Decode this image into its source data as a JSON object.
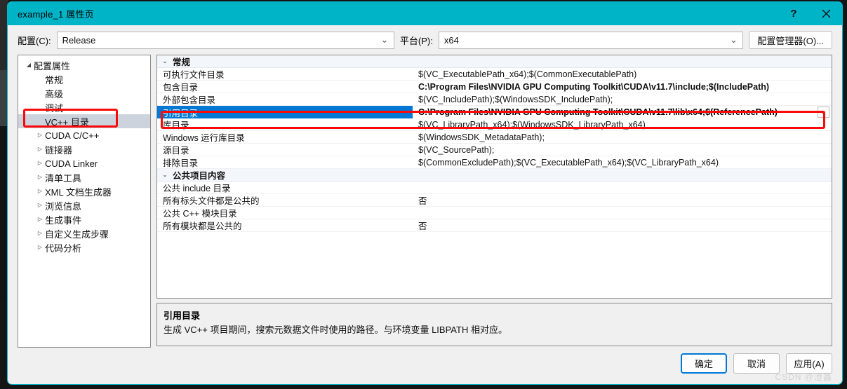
{
  "window": {
    "title": "example_1 属性页",
    "titlebar_color": "#00b4c8",
    "help_glyph": "?",
    "close_glyph": "✕"
  },
  "toolbar": {
    "config_label": "配置(C):",
    "config_value": "Release",
    "platform_label": "平台(P):",
    "platform_value": "x64",
    "config_manager_label": "配置管理器(O)...",
    "chevron_glyph": "⌄"
  },
  "tree": {
    "items": [
      {
        "label": "配置属性",
        "depth": 0,
        "expander": "expanded",
        "selected": false
      },
      {
        "label": "常规",
        "depth": 1,
        "expander": "none",
        "selected": false
      },
      {
        "label": "高级",
        "depth": 1,
        "expander": "none",
        "selected": false
      },
      {
        "label": "调试",
        "depth": 1,
        "expander": "none",
        "selected": false
      },
      {
        "label": "VC++ 目录",
        "depth": 1,
        "expander": "none",
        "selected": true
      },
      {
        "label": "CUDA C/C++",
        "depth": 1,
        "expander": "collapsed",
        "selected": false
      },
      {
        "label": "链接器",
        "depth": 1,
        "expander": "collapsed",
        "selected": false
      },
      {
        "label": "CUDA Linker",
        "depth": 1,
        "expander": "collapsed",
        "selected": false
      },
      {
        "label": "清单工具",
        "depth": 1,
        "expander": "collapsed",
        "selected": false
      },
      {
        "label": "XML 文档生成器",
        "depth": 1,
        "expander": "collapsed",
        "selected": false
      },
      {
        "label": "浏览信息",
        "depth": 1,
        "expander": "collapsed",
        "selected": false
      },
      {
        "label": "生成事件",
        "depth": 1,
        "expander": "collapsed",
        "selected": false
      },
      {
        "label": "自定义生成步骤",
        "depth": 1,
        "expander": "collapsed",
        "selected": false
      },
      {
        "label": "代码分析",
        "depth": 1,
        "expander": "collapsed",
        "selected": false
      }
    ],
    "expanded_glyph": "◢",
    "collapsed_glyph": "▷"
  },
  "grid": {
    "category_expanded_glyph": "⌄",
    "dropdown_glyph": "⌄",
    "rows": [
      {
        "kind": "category",
        "name": "常规",
        "value": ""
      },
      {
        "kind": "prop",
        "name": "可执行文件目录",
        "value": "$(VC_ExecutablePath_x64);$(CommonExecutablePath)",
        "bold": false,
        "selected": false
      },
      {
        "kind": "prop",
        "name": "包含目录",
        "value": "C:\\Program Files\\NVIDIA GPU Computing Toolkit\\CUDA\\v11.7\\include;$(IncludePath)",
        "bold": true,
        "selected": false
      },
      {
        "kind": "prop",
        "name": "外部包含目录",
        "value": "$(VC_IncludePath);$(WindowsSDK_IncludePath);",
        "bold": false,
        "selected": false
      },
      {
        "kind": "prop",
        "name": "引用目录",
        "value": "C:\\Program Files\\NVIDIA GPU Computing Toolkit\\CUDA\\v11.7\\lib\\x64;$(ReferencePath)",
        "bold": true,
        "selected": true
      },
      {
        "kind": "prop",
        "name": "库目录",
        "value": "$(VC_LibraryPath_x64);$(WindowsSDK_LibraryPath_x64)",
        "bold": false,
        "selected": false
      },
      {
        "kind": "prop",
        "name": "Windows 运行库目录",
        "value": "$(WindowsSDK_MetadataPath);",
        "bold": false,
        "selected": false
      },
      {
        "kind": "prop",
        "name": "源目录",
        "value": "$(VC_SourcePath);",
        "bold": false,
        "selected": false
      },
      {
        "kind": "prop",
        "name": "排除目录",
        "value": "$(CommonExcludePath);$(VC_ExecutablePath_x64);$(VC_LibraryPath_x64)",
        "bold": false,
        "selected": false
      },
      {
        "kind": "category",
        "name": "公共项目内容",
        "value": ""
      },
      {
        "kind": "prop",
        "name": "公共 include 目录",
        "value": "",
        "bold": false,
        "selected": false
      },
      {
        "kind": "prop",
        "name": "所有标头文件都是公共的",
        "value": "否",
        "bold": false,
        "selected": false
      },
      {
        "kind": "prop",
        "name": "公共 C++ 模块目录",
        "value": "",
        "bold": false,
        "selected": false
      },
      {
        "kind": "prop",
        "name": "所有模块都是公共的",
        "value": "否",
        "bold": false,
        "selected": false
      }
    ]
  },
  "description": {
    "title": "引用目录",
    "text": "生成 VC++ 项目期间，搜索元数据文件时使用的路径。与环境变量 LIBPATH 相对应。"
  },
  "footer": {
    "ok_label": "确定",
    "cancel_label": "取消",
    "apply_label": "应用(A)",
    "watermark": "CSDN @澄鑫"
  },
  "annotations": {
    "accent_red": "#fb0a0a",
    "selection_blue": "#0078d4"
  }
}
